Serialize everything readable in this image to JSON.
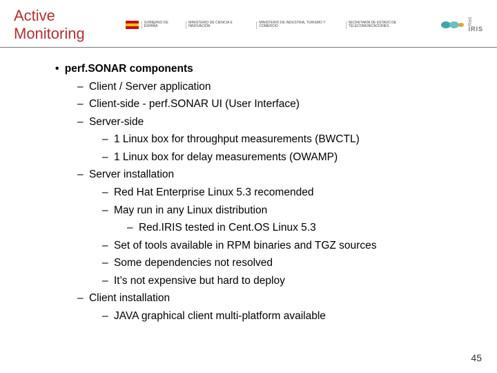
{
  "title": "Active Monitoring",
  "logos": {
    "gov": [
      "GOBIERNO DE ESPAÑA",
      "MINISTERIO DE CIENCIA E INNOVACIÓN",
      "MINISTERIO DE INDUSTRIA, TURISMO Y COMERCIO",
      "SECRETARÍA DE ESTADO DE TELECOMUNICACIONES"
    ],
    "iris_top": "Red",
    "iris_main": "IRIS"
  },
  "b0": "perf.SONAR components",
  "b0_0": "Client / Server application",
  "b0_1": "Client-side - perf.SONAR UI (User Interface)",
  "b0_2": "Server-side",
  "b0_2_0": "1 Linux box for throughput measurements (BWCTL)",
  "b0_2_1": "1 Linux box for delay measurements (OWAMP)",
  "b0_3": "Server installation",
  "b0_3_0": "Red Hat Enterprise Linux 5.3 recomended",
  "b0_3_1": "May run in any Linux distribution",
  "b0_3_1_0": "Red.IRIS tested in Cent.OS Linux 5.3",
  "b0_3_2": "Set of tools available in RPM binaries and TGZ sources",
  "b0_3_3": "Some dependencies not resolved",
  "b0_3_4": "It’s not expensive but hard to deploy",
  "b0_4": "Client installation",
  "b0_4_0": "JAVA graphical client multi-platform available",
  "page_number": "45"
}
